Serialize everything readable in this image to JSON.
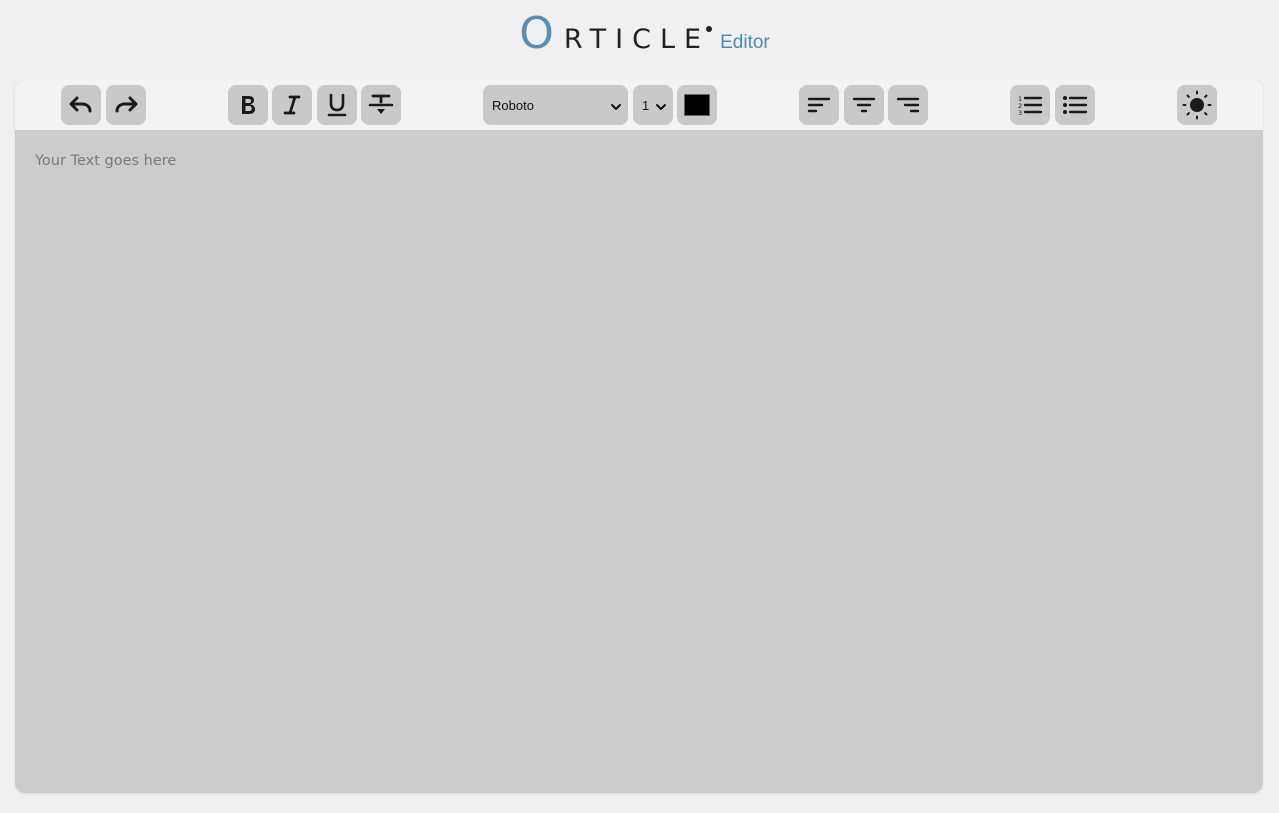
{
  "app": {
    "logo_initial": "O",
    "logo_rest": "RTICLE",
    "logo_subtitle": "Editor",
    "accent_color": "#5b8db4"
  },
  "toolbar": {
    "history": [
      {
        "name": "undo-button",
        "icon": "undo-icon"
      },
      {
        "name": "redo-button",
        "icon": "redo-icon"
      }
    ],
    "format": [
      {
        "name": "bold-button",
        "icon": "bold-icon"
      },
      {
        "name": "italic-button",
        "icon": "italic-icon"
      },
      {
        "name": "underline-button",
        "icon": "underline-icon"
      },
      {
        "name": "strikethrough-button",
        "icon": "strikethrough-icon"
      }
    ],
    "font_family": "Roboto",
    "font_size": "1",
    "font_color": "#000000",
    "align": [
      {
        "name": "align-left-button",
        "icon": "align-left-icon"
      },
      {
        "name": "align-center-button",
        "icon": "align-center-icon"
      },
      {
        "name": "align-right-button",
        "icon": "align-right-icon"
      }
    ],
    "lists": [
      {
        "name": "ordered-list-button",
        "icon": "ordered-list-icon"
      },
      {
        "name": "unordered-list-button",
        "icon": "unordered-list-icon"
      }
    ],
    "theme": {
      "name": "theme-toggle-button",
      "icon": "sun-icon"
    }
  },
  "editor": {
    "placeholder": "Your Text goes here",
    "content": ""
  }
}
